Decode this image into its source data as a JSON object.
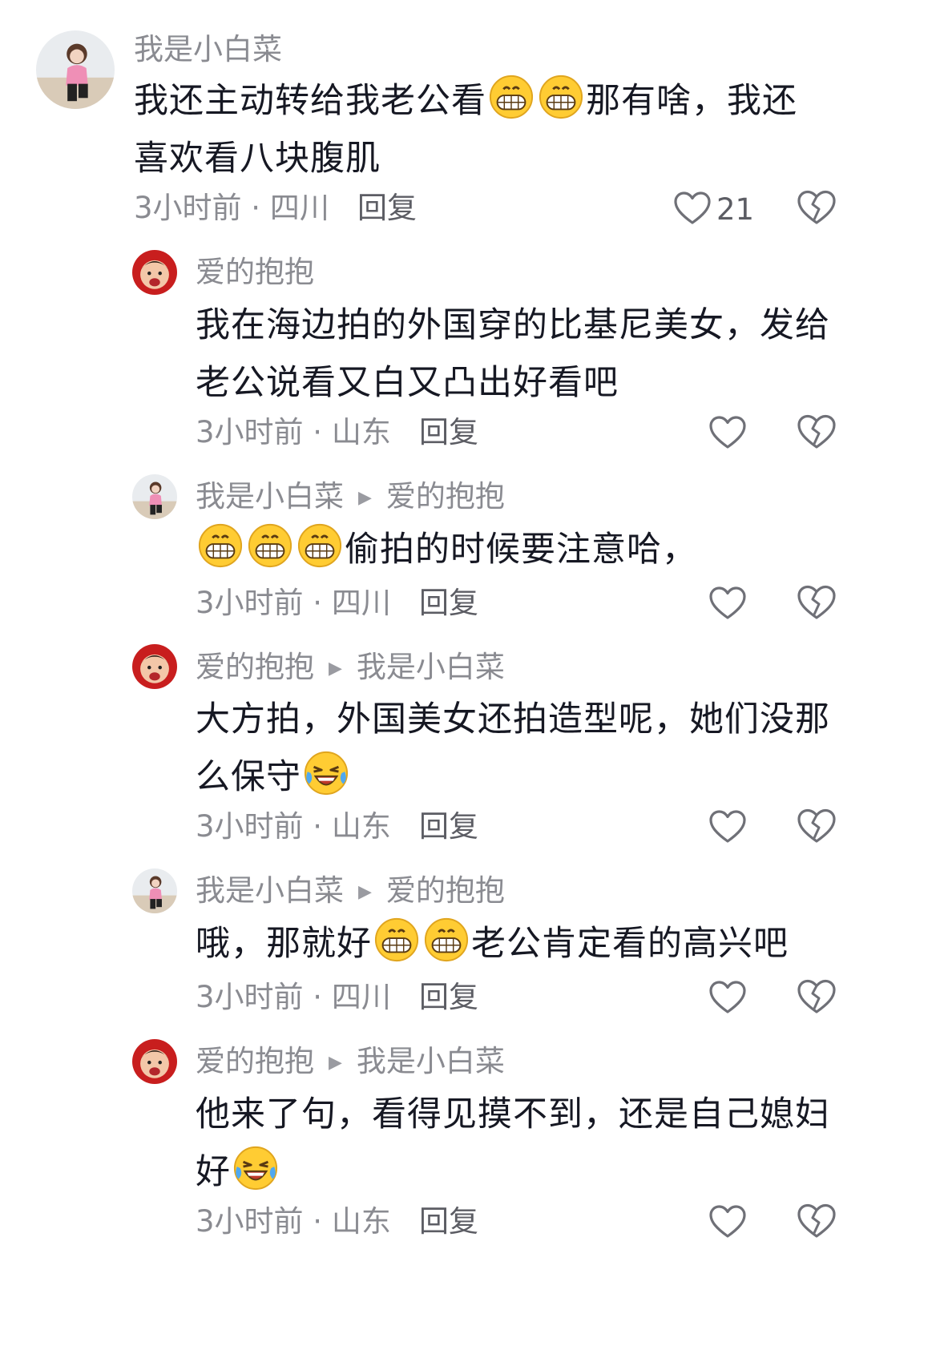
{
  "comments": [
    {
      "author": "我是小白菜",
      "segments": [
        {
          "t": "我还主动转给我老公看"
        },
        {
          "e": "grin"
        },
        {
          "e": "grin"
        },
        {
          "t": "那有啥，我还喜欢看八块腹肌"
        }
      ],
      "time_location": "3小时前 · 四川",
      "reply_label": "回复",
      "like_count": "21"
    },
    {
      "author": "爱的抱抱",
      "segments": [
        {
          "t": "我在海边拍的外国穿的比基尼美女，发给老公说看又白又凸出好看吧"
        }
      ],
      "time_location": "3小时前 · 山东",
      "reply_label": "回复"
    },
    {
      "author": "我是小白菜",
      "reply_to": "爱的抱抱",
      "segments": [
        {
          "e": "grin"
        },
        {
          "e": "grin"
        },
        {
          "e": "grin"
        },
        {
          "t": "偷拍的时候要注意哈，"
        }
      ],
      "time_location": "3小时前 · 四川",
      "reply_label": "回复"
    },
    {
      "author": "爱的抱抱",
      "reply_to": "我是小白菜",
      "segments": [
        {
          "t": "大方拍，外国美女还拍造型呢，她们没那么保守"
        },
        {
          "e": "laughcry"
        }
      ],
      "time_location": "3小时前 · 山东",
      "reply_label": "回复"
    },
    {
      "author": "我是小白菜",
      "reply_to": "爱的抱抱",
      "segments": [
        {
          "t": "哦，那就好"
        },
        {
          "e": "grin"
        },
        {
          "e": "grin"
        },
        {
          "t": "老公肯定看的高兴吧"
        }
      ],
      "time_location": "3小时前 · 四川",
      "reply_label": "回复"
    },
    {
      "author": "爱的抱抱",
      "reply_to": "我是小白菜",
      "segments": [
        {
          "t": "他来了句，看得见摸不到，还是自己媳妇好"
        },
        {
          "e": "laughcry"
        }
      ],
      "time_location": "3小时前 · 山东",
      "reply_label": "回复"
    }
  ],
  "icons": {
    "reply_arrow": "play-triangle-icon",
    "like": "heart-outline-icon",
    "dislike": "broken-heart-outline-icon",
    "emoji_grin": "grin-emoji-icon",
    "emoji_laughcry": "laugh-cry-emoji-icon"
  },
  "colors": {
    "text": "#161823",
    "secondary": "#8a8b91",
    "reply": "#5c5d64",
    "icon": "#6f7077"
  }
}
